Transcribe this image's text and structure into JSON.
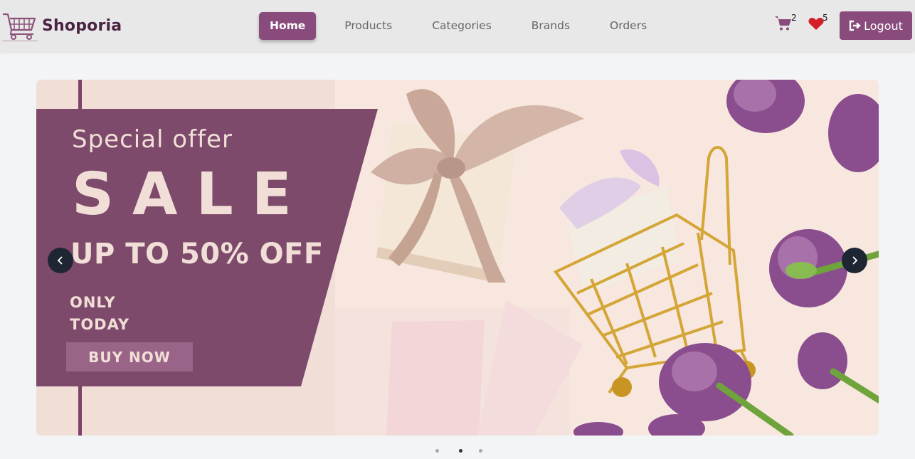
{
  "brand": {
    "name": "Shoporia",
    "logo_icon": "shopping-cart-logo-icon"
  },
  "nav": {
    "items": [
      {
        "label": "Home",
        "active": true
      },
      {
        "label": "Products",
        "active": false
      },
      {
        "label": "Categories",
        "active": false
      },
      {
        "label": "Brands",
        "active": false
      },
      {
        "label": "Orders",
        "active": false
      }
    ]
  },
  "header_actions": {
    "cart": {
      "icon": "cart-icon",
      "count": "2"
    },
    "wishlist": {
      "icon": "heart-icon",
      "count": "5"
    },
    "logout_label": "Logout",
    "logout_icon": "logout-icon"
  },
  "carousel": {
    "slide": {
      "special": "Special offer",
      "sale": "SALE",
      "discount": "UP TO 50% OFF",
      "only": "ONLY",
      "today": "TODAY",
      "cta": "BUY NOW"
    },
    "prev_icon": "chevron-left-icon",
    "next_icon": "chevron-right-icon",
    "indicators": {
      "count": 3,
      "active": 1
    }
  },
  "colors": {
    "accent": "#894a7c",
    "promo": "#7d4a6b",
    "promo_text": "#f1dfd7",
    "header_bg": "#e8e8e9",
    "page_bg": "#f3f4f6",
    "wishlist": "#d42027",
    "carousel_control": "#1f2633"
  }
}
